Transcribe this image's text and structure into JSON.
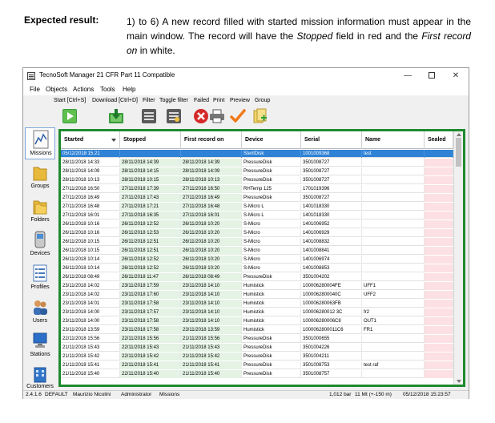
{
  "doc": {
    "label": "Expected result:",
    "text_part1": "1) to 6) A new record filled with started mission information must appear in the main window. The record will have the ",
    "text_em1": "Stopped",
    "text_part2": " field in red and the ",
    "text_em2": "First record on",
    "text_part3": " in white."
  },
  "window": {
    "title": "TecnoSoft Manager 21 CFR Part 11 Compatible",
    "controls": {
      "minimize": "—",
      "close": "✕"
    }
  },
  "menu": [
    "File",
    "Objects",
    "Actions",
    "Tools",
    "Help"
  ],
  "toolbar": {
    "labels": [
      "Start [Ctrl+S]",
      "Download [Ctrl+D]",
      "Filter",
      "Toggle filter",
      "Failed",
      "Print",
      "Preview",
      "Group"
    ],
    "icons": [
      "start-icon",
      "download-icon",
      "filter-icon",
      "toggle-filter-icon",
      "failed-icon",
      "print-icon",
      "preview-icon",
      "group-icon"
    ]
  },
  "nav": [
    {
      "label": "Missions",
      "icon": "missions-icon",
      "active": true
    },
    {
      "label": "Groups",
      "icon": "groups-icon"
    },
    {
      "label": "Folders",
      "icon": "folders-icon"
    },
    {
      "label": "Devices",
      "icon": "devices-icon"
    },
    {
      "label": "Profiles",
      "icon": "profiles-icon"
    },
    {
      "label": "Users",
      "icon": "users-icon"
    },
    {
      "label": "Stations",
      "icon": "stations-icon"
    },
    {
      "label": "Customers",
      "icon": "customers-icon"
    }
  ],
  "table": {
    "columns": [
      "Started",
      "Stopped",
      "First record on",
      "Device",
      "Serial",
      "Name",
      "Sealed"
    ],
    "rows": [
      [
        "05/12/2018 15.21",
        "",
        "",
        "SterilDisk",
        "1001009368",
        "test",
        ""
      ],
      [
        "28/11/2018 14:33",
        "28/11/2018 14:39",
        "28/11/2018 14:39",
        "PressureDisk",
        "3501008727",
        "",
        ""
      ],
      [
        "28/11/2018 14:09",
        "28/11/2018 14:15",
        "28/11/2018 14:09",
        "PressureDisk",
        "3501008727",
        "",
        ""
      ],
      [
        "28/11/2018 10:13",
        "28/11/2018 10:15",
        "28/11/2018 10:13",
        "PressureDisk",
        "3501008727",
        "",
        ""
      ],
      [
        "27/11/2018 16:50",
        "27/11/2018 17:39",
        "27/11/2018 16:50",
        "RHTemp 125",
        "1701019396",
        "",
        ""
      ],
      [
        "27/11/2018 16:49",
        "27/11/2018 17:43",
        "27/11/2018 16:49",
        "PressureDisk",
        "3501008727",
        "",
        ""
      ],
      [
        "27/11/2018 16:48",
        "27/11/2018 17:21",
        "27/11/2018 16:48",
        "S-Micro L",
        "1401018330",
        "",
        ""
      ],
      [
        "27/11/2018 16:01",
        "27/11/2018 16:35",
        "27/11/2018 16:01",
        "S-Micro L",
        "1401018330",
        "",
        ""
      ],
      [
        "26/11/2018 10:16",
        "26/11/2018 12:52",
        "26/11/2018 10:20",
        "S-Micro",
        "1401006952",
        "",
        ""
      ],
      [
        "26/11/2018 10:16",
        "26/11/2018 12:53",
        "26/11/2018 10:20",
        "S-Micro",
        "1401006929",
        "",
        ""
      ],
      [
        "26/11/2018 10:15",
        "26/11/2018 12:51",
        "26/11/2018 10:20",
        "S-Micro",
        "1401008832",
        "",
        ""
      ],
      [
        "26/11/2018 10:15",
        "26/11/2018 12:51",
        "26/11/2018 10:20",
        "S-Micro",
        "1401008841",
        "",
        ""
      ],
      [
        "26/11/2018 10:14",
        "26/11/2018 12:52",
        "26/11/2018 10:20",
        "S-Micro",
        "1401006974",
        "",
        ""
      ],
      [
        "26/11/2018 10:14",
        "26/11/2018 12:52",
        "26/11/2018 10:20",
        "S-Micro",
        "1401008853",
        "",
        ""
      ],
      [
        "26/11/2018 08:49",
        "26/11/2018 11:47",
        "26/11/2018 08:49",
        "PressureDisk",
        "3501004202",
        "",
        ""
      ],
      [
        "23/11/2018 14:02",
        "23/11/2018 17:59",
        "23/11/2018 14:10",
        "Humistick",
        "100006280004FE",
        "UFF1",
        ""
      ],
      [
        "23/11/2018 14:02",
        "23/11/2018 17:60",
        "23/11/2018 14:10",
        "Humistick",
        "1000062800040C",
        "UFF2",
        ""
      ],
      [
        "23/11/2018 14:01",
        "23/11/2018 17:58",
        "23/11/2018 14:10",
        "Humistick",
        "100006280063FB",
        "",
        ""
      ],
      [
        "23/11/2018 14:00",
        "23/11/2018 17:57",
        "23/11/2018 14:10",
        "Humistick",
        "100006280012 3C",
        "fr2",
        ""
      ],
      [
        "23/11/2018 14:00",
        "23/11/2018 17:58",
        "23/11/2018 14:10",
        "Humistick",
        "100006280006C8",
        "OUT1",
        ""
      ],
      [
        "23/11/2018 13:59",
        "23/11/2018 17:58",
        "23/11/2018 13:59",
        "Humistick",
        "1000062800011C6",
        "FR1",
        ""
      ],
      [
        "22/11/2018 15:56",
        "22/11/2018 15:56",
        "21/11/2018 15:56",
        "PressureDisk",
        "3501000655",
        "",
        ""
      ],
      [
        "21/11/2018 15:43",
        "22/11/2018 15:43",
        "21/11/2018 15:43",
        "PressureDisk",
        "3501004226",
        "",
        ""
      ],
      [
        "21/11/2018 15:42",
        "22/11/2018 15:42",
        "21/11/2018 15:42",
        "PressureDisk",
        "3501004211",
        "",
        ""
      ],
      [
        "21/11/2018 15:41",
        "22/11/2018 15:41",
        "21/11/2018 15:41",
        "PressureDisk",
        "3501008753",
        "test raf",
        ""
      ],
      [
        "21/11/2018 15:40",
        "22/11/2018 15:40",
        "21/11/2018 15:40",
        "PressureDisk",
        "3501008757",
        "",
        ""
      ]
    ]
  },
  "status": {
    "version": "2.4.1.6",
    "profile": "DEFAULT",
    "user_name": "Maurizio Nicolini",
    "role": "Administrator",
    "section": "Missions",
    "pressure": "1,012 bar",
    "altitude": "11 Mt (+-150 m)",
    "datetime": "05/12/2018 15:23:57"
  },
  "colors": {
    "accent": "#2f82d6",
    "highlight_border": "#1f8a2e",
    "sealed_bg": "#fde0e3",
    "stopped_bg": "#e4f3e4"
  }
}
